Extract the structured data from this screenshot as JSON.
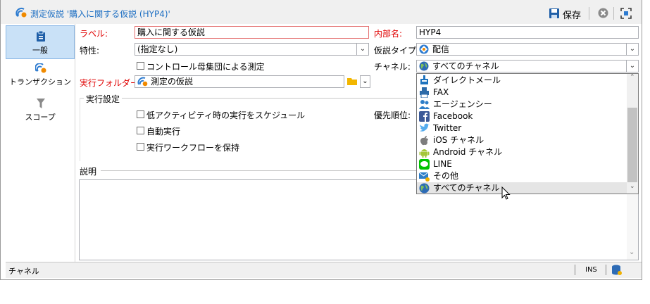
{
  "window": {
    "title": "測定仮説 '購入に関する仮説 (HYP4)'",
    "save_label": "保存"
  },
  "sidebar": {
    "items": [
      {
        "label": "一般",
        "icon": "clipboard-icon",
        "selected": true
      },
      {
        "label": "トランザクション",
        "icon": "transaction-icon",
        "selected": false
      },
      {
        "label": "スコープ",
        "icon": "filter-icon",
        "selected": false
      }
    ]
  },
  "form": {
    "label_caption": "ラベル:",
    "label_value": "購入に関する仮説",
    "internal_name_caption": "内部名:",
    "internal_name_value": "HYP4",
    "attribute_caption": "特性:",
    "attribute_value": "(指定なし)",
    "hypothesis_type_caption": "仮説タイプ:",
    "hypothesis_type_value": "配信",
    "control_group_label": "コントロール母集団による測定",
    "channel_caption": "チャネル:",
    "channel_value": "すべてのチャネル",
    "exec_folder_caption": "実行フォルダー:",
    "exec_folder_value": "測定の仮説"
  },
  "exec_settings": {
    "title": "実行設定",
    "priority_caption": "優先順位:",
    "options": [
      "低アクティビティ時の実行をスケジュール",
      "自動実行",
      "実行ワークフローを保持"
    ]
  },
  "description": {
    "title": "説明"
  },
  "channel_dropdown": {
    "options": [
      {
        "label": "ダイレクトメール",
        "icon": "direct-mail-icon",
        "color": "#1e73be"
      },
      {
        "label": "FAX",
        "icon": "fax-icon",
        "color": "#2c6aa8"
      },
      {
        "label": "エージェンシー",
        "icon": "agency-icon",
        "color": "#2e7ec8"
      },
      {
        "label": "Facebook",
        "icon": "facebook-icon",
        "color": "#3b5998"
      },
      {
        "label": "Twitter",
        "icon": "twitter-icon",
        "color": "#55acee"
      },
      {
        "label": "iOS チャネル",
        "icon": "apple-icon",
        "color": "#7d7d7d"
      },
      {
        "label": "Android チャネル",
        "icon": "android-icon",
        "color": "#a4c639"
      },
      {
        "label": "LINE",
        "icon": "line-icon",
        "color": "#00c300"
      },
      {
        "label": "その他",
        "icon": "other-icon",
        "color": "#2e7ec8"
      },
      {
        "label": "すべてのチャネル",
        "icon": "globe-icon",
        "color": "#2d6bb5"
      }
    ],
    "hovered": "すべてのチャネル"
  },
  "statusbar": {
    "text": "チャネル",
    "mode": "INS"
  },
  "colors": {
    "accent": "#1a6dc2",
    "required": "#e00000",
    "selection": "#c9e1f7"
  }
}
